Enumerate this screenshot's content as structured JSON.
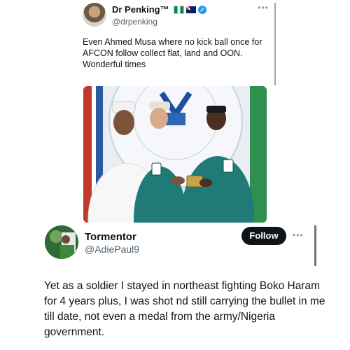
{
  "quoted_tweet": {
    "name": "Dr Penking™",
    "handle": "@drpenking",
    "more_label": "•••",
    "text": "Even Ahmed Musa where no kick ball once for AFCON follow collect flat, land and OON. Wonderful times",
    "flags": [
      "nigeria-flag-icon",
      "australia-flag-icon"
    ],
    "verified_color": "#1d9bf0"
  },
  "reply_tweet": {
    "name": "Tormentor",
    "handle": "@AdiePaul9",
    "follow_label": "Follow",
    "more_label": "•••",
    "text": "Yet as a soldier I stayed in northeast fighting Boko Haram for 4 years plus, I was shot nd still carrying the bullet in me till date, not even a medal from the army/Nigeria government."
  },
  "colors": {
    "text_primary": "#0f1419",
    "text_secondary": "#536471",
    "follow_bg": "#0f1419",
    "agbada_green": "#1f7a78"
  }
}
